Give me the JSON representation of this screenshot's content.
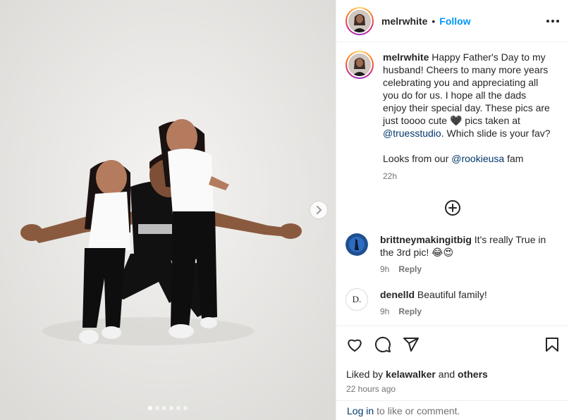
{
  "post": {
    "username": "melrwhite",
    "separator": "•",
    "follow_label": "Follow",
    "more_icon": "more-horizontal-icon"
  },
  "caption": {
    "username": "melrwhite",
    "text_1": " Happy Father's Day to my husband! Cheers to many more years celebrating you and appreciating all you do for us. I hope all the dads enjoy their special day. These pics are just toooo cute ",
    "emoji_heart": "🖤",
    "text_2": " pics taken at ",
    "mention_1": "@truesstudio",
    "text_3": ". Which slide is your fav?",
    "text_4": "Looks from our ",
    "mention_2": "@rookieusa",
    "text_5": " fam",
    "time": "22h"
  },
  "load_more_icon": "plus-circle-icon",
  "comments": [
    {
      "username": "brittneymakingitbig",
      "text": " It's really True in the 3rd pic! 😂😍",
      "time": "9h",
      "reply_label": "Reply"
    },
    {
      "username": "denelld",
      "avatar_letter": "D.",
      "text": " Beautiful family!",
      "time": "9h",
      "reply_label": "Reply"
    }
  ],
  "actions": {
    "like_icon": "heart-icon",
    "comment_icon": "comment-icon",
    "share_icon": "share-icon",
    "save_icon": "bookmark-icon"
  },
  "likes": {
    "prefix": "Liked by ",
    "user": "kelawalker",
    "middle": " and ",
    "others": "others"
  },
  "posted_ago": "22 hours ago",
  "login": {
    "link": "Log in",
    "text": "to like or comment."
  },
  "carousel": {
    "slides": 6,
    "active": 1
  },
  "colors": {
    "accent": "#0095f6",
    "mention": "#00376b",
    "muted": "#737373",
    "text": "#262626"
  }
}
